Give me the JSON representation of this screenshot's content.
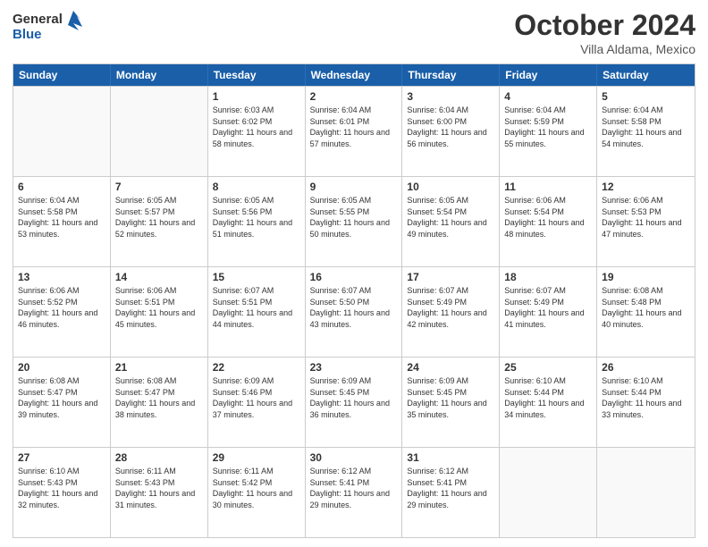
{
  "header": {
    "logo_line1": "General",
    "logo_line2": "Blue",
    "month": "October 2024",
    "location": "Villa Aldama, Mexico"
  },
  "weekdays": [
    "Sunday",
    "Monday",
    "Tuesday",
    "Wednesday",
    "Thursday",
    "Friday",
    "Saturday"
  ],
  "rows": [
    [
      {
        "day": "",
        "sunrise": "",
        "sunset": "",
        "daylight": ""
      },
      {
        "day": "",
        "sunrise": "",
        "sunset": "",
        "daylight": ""
      },
      {
        "day": "1",
        "sunrise": "Sunrise: 6:03 AM",
        "sunset": "Sunset: 6:02 PM",
        "daylight": "Daylight: 11 hours and 58 minutes."
      },
      {
        "day": "2",
        "sunrise": "Sunrise: 6:04 AM",
        "sunset": "Sunset: 6:01 PM",
        "daylight": "Daylight: 11 hours and 57 minutes."
      },
      {
        "day": "3",
        "sunrise": "Sunrise: 6:04 AM",
        "sunset": "Sunset: 6:00 PM",
        "daylight": "Daylight: 11 hours and 56 minutes."
      },
      {
        "day": "4",
        "sunrise": "Sunrise: 6:04 AM",
        "sunset": "Sunset: 5:59 PM",
        "daylight": "Daylight: 11 hours and 55 minutes."
      },
      {
        "day": "5",
        "sunrise": "Sunrise: 6:04 AM",
        "sunset": "Sunset: 5:58 PM",
        "daylight": "Daylight: 11 hours and 54 minutes."
      }
    ],
    [
      {
        "day": "6",
        "sunrise": "Sunrise: 6:04 AM",
        "sunset": "Sunset: 5:58 PM",
        "daylight": "Daylight: 11 hours and 53 minutes."
      },
      {
        "day": "7",
        "sunrise": "Sunrise: 6:05 AM",
        "sunset": "Sunset: 5:57 PM",
        "daylight": "Daylight: 11 hours and 52 minutes."
      },
      {
        "day": "8",
        "sunrise": "Sunrise: 6:05 AM",
        "sunset": "Sunset: 5:56 PM",
        "daylight": "Daylight: 11 hours and 51 minutes."
      },
      {
        "day": "9",
        "sunrise": "Sunrise: 6:05 AM",
        "sunset": "Sunset: 5:55 PM",
        "daylight": "Daylight: 11 hours and 50 minutes."
      },
      {
        "day": "10",
        "sunrise": "Sunrise: 6:05 AM",
        "sunset": "Sunset: 5:54 PM",
        "daylight": "Daylight: 11 hours and 49 minutes."
      },
      {
        "day": "11",
        "sunrise": "Sunrise: 6:06 AM",
        "sunset": "Sunset: 5:54 PM",
        "daylight": "Daylight: 11 hours and 48 minutes."
      },
      {
        "day": "12",
        "sunrise": "Sunrise: 6:06 AM",
        "sunset": "Sunset: 5:53 PM",
        "daylight": "Daylight: 11 hours and 47 minutes."
      }
    ],
    [
      {
        "day": "13",
        "sunrise": "Sunrise: 6:06 AM",
        "sunset": "Sunset: 5:52 PM",
        "daylight": "Daylight: 11 hours and 46 minutes."
      },
      {
        "day": "14",
        "sunrise": "Sunrise: 6:06 AM",
        "sunset": "Sunset: 5:51 PM",
        "daylight": "Daylight: 11 hours and 45 minutes."
      },
      {
        "day": "15",
        "sunrise": "Sunrise: 6:07 AM",
        "sunset": "Sunset: 5:51 PM",
        "daylight": "Daylight: 11 hours and 44 minutes."
      },
      {
        "day": "16",
        "sunrise": "Sunrise: 6:07 AM",
        "sunset": "Sunset: 5:50 PM",
        "daylight": "Daylight: 11 hours and 43 minutes."
      },
      {
        "day": "17",
        "sunrise": "Sunrise: 6:07 AM",
        "sunset": "Sunset: 5:49 PM",
        "daylight": "Daylight: 11 hours and 42 minutes."
      },
      {
        "day": "18",
        "sunrise": "Sunrise: 6:07 AM",
        "sunset": "Sunset: 5:49 PM",
        "daylight": "Daylight: 11 hours and 41 minutes."
      },
      {
        "day": "19",
        "sunrise": "Sunrise: 6:08 AM",
        "sunset": "Sunset: 5:48 PM",
        "daylight": "Daylight: 11 hours and 40 minutes."
      }
    ],
    [
      {
        "day": "20",
        "sunrise": "Sunrise: 6:08 AM",
        "sunset": "Sunset: 5:47 PM",
        "daylight": "Daylight: 11 hours and 39 minutes."
      },
      {
        "day": "21",
        "sunrise": "Sunrise: 6:08 AM",
        "sunset": "Sunset: 5:47 PM",
        "daylight": "Daylight: 11 hours and 38 minutes."
      },
      {
        "day": "22",
        "sunrise": "Sunrise: 6:09 AM",
        "sunset": "Sunset: 5:46 PM",
        "daylight": "Daylight: 11 hours and 37 minutes."
      },
      {
        "day": "23",
        "sunrise": "Sunrise: 6:09 AM",
        "sunset": "Sunset: 5:45 PM",
        "daylight": "Daylight: 11 hours and 36 minutes."
      },
      {
        "day": "24",
        "sunrise": "Sunrise: 6:09 AM",
        "sunset": "Sunset: 5:45 PM",
        "daylight": "Daylight: 11 hours and 35 minutes."
      },
      {
        "day": "25",
        "sunrise": "Sunrise: 6:10 AM",
        "sunset": "Sunset: 5:44 PM",
        "daylight": "Daylight: 11 hours and 34 minutes."
      },
      {
        "day": "26",
        "sunrise": "Sunrise: 6:10 AM",
        "sunset": "Sunset: 5:44 PM",
        "daylight": "Daylight: 11 hours and 33 minutes."
      }
    ],
    [
      {
        "day": "27",
        "sunrise": "Sunrise: 6:10 AM",
        "sunset": "Sunset: 5:43 PM",
        "daylight": "Daylight: 11 hours and 32 minutes."
      },
      {
        "day": "28",
        "sunrise": "Sunrise: 6:11 AM",
        "sunset": "Sunset: 5:43 PM",
        "daylight": "Daylight: 11 hours and 31 minutes."
      },
      {
        "day": "29",
        "sunrise": "Sunrise: 6:11 AM",
        "sunset": "Sunset: 5:42 PM",
        "daylight": "Daylight: 11 hours and 30 minutes."
      },
      {
        "day": "30",
        "sunrise": "Sunrise: 6:12 AM",
        "sunset": "Sunset: 5:41 PM",
        "daylight": "Daylight: 11 hours and 29 minutes."
      },
      {
        "day": "31",
        "sunrise": "Sunrise: 6:12 AM",
        "sunset": "Sunset: 5:41 PM",
        "daylight": "Daylight: 11 hours and 29 minutes."
      },
      {
        "day": "",
        "sunrise": "",
        "sunset": "",
        "daylight": ""
      },
      {
        "day": "",
        "sunrise": "",
        "sunset": "",
        "daylight": ""
      }
    ]
  ]
}
